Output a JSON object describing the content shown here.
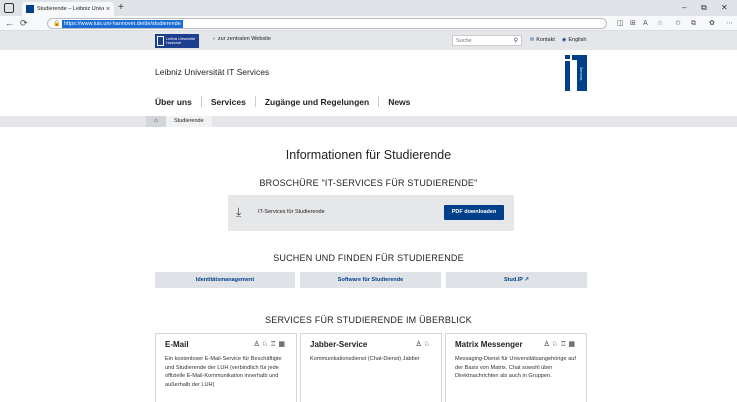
{
  "browser": {
    "tab_title": "Studierende – Leibniz Universität",
    "tab_close": "×",
    "new_tab": "+",
    "url": "https://www.luis.uni-hannover.de/de/studierende",
    "window_controls": [
      "–",
      "⧉",
      "✕"
    ]
  },
  "topbar": {
    "logo_text": "Leibniz Universität Hannover",
    "back_link": "zur zentralen Website",
    "search_placeholder": "Suche",
    "kontakt": "Kontakt",
    "english": "English"
  },
  "header": {
    "org_name": "Leibniz Universität IT Services",
    "logo_caption": "Services",
    "nav": [
      "Über uns",
      "Services",
      "Zugänge und Regelungen",
      "News"
    ]
  },
  "breadcrumb": {
    "current": "Studierende"
  },
  "main": {
    "title": "Informationen für Studierende",
    "brochure_heading": "BROSCHÜRE \"IT-SERVICES FÜR STUDIERENDE\"",
    "brochure_label": "IT-Services für Studierende",
    "download_button": "PDF downloaden",
    "search_heading": "SUCHEN UND FINDEN FÜR STUDIERENDE",
    "links": [
      "Identitätsmanagement",
      "Software für Studierende",
      "Stud.IP ↗"
    ],
    "services_heading": "SERVICES FÜR STUDIERENDE IM ÜBERBLICK"
  },
  "cards": [
    {
      "title": "E-Mail",
      "icons": [
        "person-icon",
        "group-icon",
        "staff-icon",
        "institution-icon"
      ],
      "desc": "Ein kostenloser E-Mail-Service für Beschäftigte und Studierende der LUH (verbindlich für jede offizielle E-Mail-Kommunikation innerhalb und außerhalb der LUH)"
    },
    {
      "title": "Jabber-Service",
      "icons": [
        "person-icon",
        "group-icon"
      ],
      "desc": "Kommunikationsdienst (Chat-Dienst) Jabber"
    },
    {
      "title": "Matrix Messenger",
      "icons": [
        "person-icon",
        "group-icon",
        "staff-icon",
        "institution-icon"
      ],
      "desc": "Messaging-Dienst für Universitätsangehörige auf der Basis von Matrix. Chat sowohl über Direktnachrichten als auch in Gruppen."
    }
  ]
}
